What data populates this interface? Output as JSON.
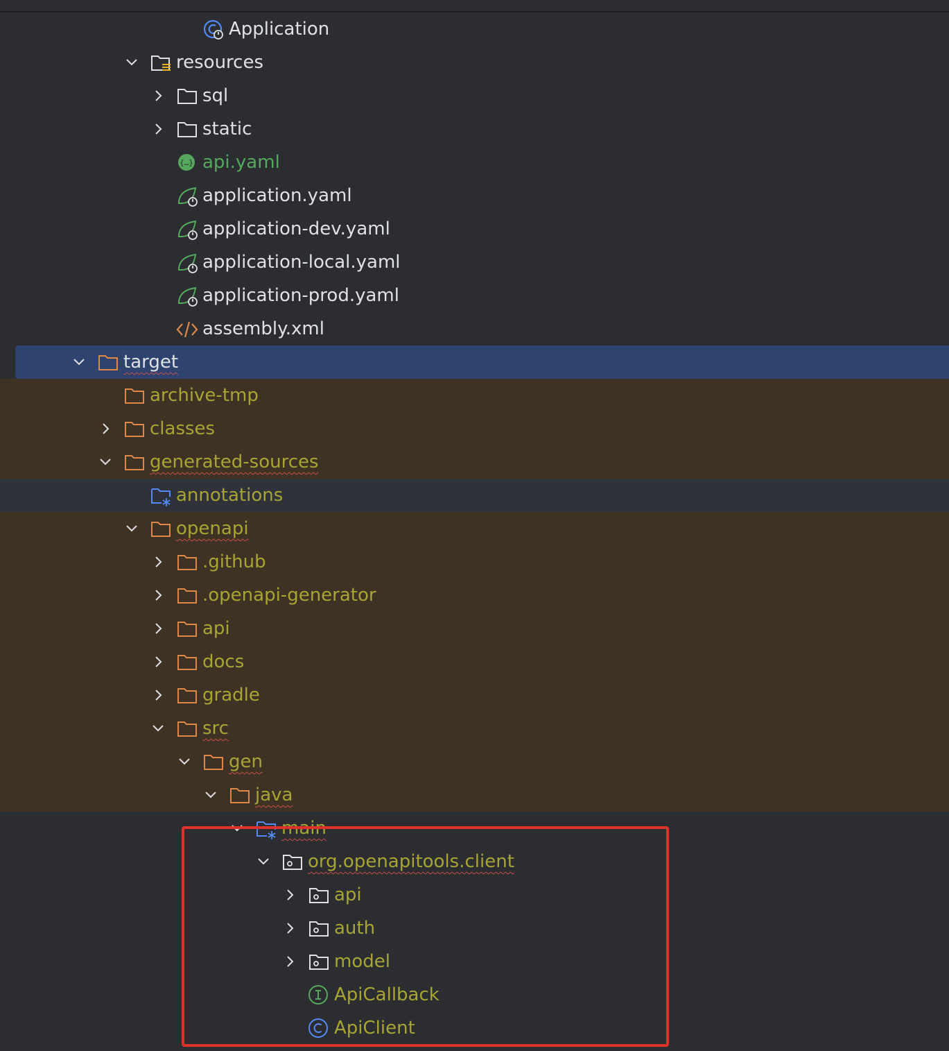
{
  "tree": {
    "items": [
      {
        "label": "Application",
        "icon": "spring-app-class-icon"
      },
      {
        "label": "resources",
        "icon": "resources-folder-icon",
        "expanded": true
      },
      {
        "label": "sql",
        "icon": "folder-icon",
        "expanded": false
      },
      {
        "label": "static",
        "icon": "folder-icon",
        "expanded": false
      },
      {
        "label": "api.yaml",
        "icon": "openapi-file-icon"
      },
      {
        "label": "application.yaml",
        "icon": "spring-config-icon"
      },
      {
        "label": "application-dev.yaml",
        "icon": "spring-config-icon"
      },
      {
        "label": "application-local.yaml",
        "icon": "spring-config-icon"
      },
      {
        "label": "application-prod.yaml",
        "icon": "spring-config-icon"
      },
      {
        "label": "assembly.xml",
        "icon": "xml-file-icon"
      },
      {
        "label": "target",
        "icon": "excluded-folder-icon",
        "expanded": true,
        "selected": true
      },
      {
        "label": "archive-tmp",
        "icon": "excluded-folder-icon"
      },
      {
        "label": "classes",
        "icon": "excluded-folder-icon",
        "expanded": false
      },
      {
        "label": "generated-sources",
        "icon": "excluded-folder-icon",
        "expanded": true
      },
      {
        "label": "annotations",
        "icon": "generated-sources-root-icon"
      },
      {
        "label": "openapi",
        "icon": "excluded-folder-icon",
        "expanded": true
      },
      {
        "label": ".github",
        "icon": "excluded-folder-icon",
        "expanded": false
      },
      {
        "label": ".openapi-generator",
        "icon": "excluded-folder-icon",
        "expanded": false
      },
      {
        "label": "api",
        "icon": "excluded-folder-icon",
        "expanded": false
      },
      {
        "label": "docs",
        "icon": "excluded-folder-icon",
        "expanded": false
      },
      {
        "label": "gradle",
        "icon": "excluded-folder-icon",
        "expanded": false
      },
      {
        "label": "src",
        "icon": "excluded-folder-icon",
        "expanded": true
      },
      {
        "label": "gen",
        "icon": "excluded-folder-icon",
        "expanded": true
      },
      {
        "label": "java",
        "icon": "excluded-folder-icon",
        "expanded": true
      },
      {
        "label": "main",
        "icon": "generated-sources-root-icon",
        "expanded": true
      },
      {
        "label": "org.openapitools.client",
        "icon": "package-icon",
        "expanded": true
      },
      {
        "label": "api",
        "icon": "package-icon",
        "expanded": false
      },
      {
        "label": "auth",
        "icon": "package-icon",
        "expanded": false
      },
      {
        "label": "model",
        "icon": "package-icon",
        "expanded": false
      },
      {
        "label": "ApiCallback",
        "icon": "interface-icon"
      },
      {
        "label": "ApiClient",
        "icon": "class-icon"
      }
    ]
  },
  "colors": {
    "background": "#2b2d30",
    "excluded_background": "#3d3223",
    "selection": "#2e436e",
    "excluded_text": "#a8a435",
    "default_text": "#dfe1e5",
    "green_text": "#56a85e",
    "highlight_border": "#e0302a"
  }
}
